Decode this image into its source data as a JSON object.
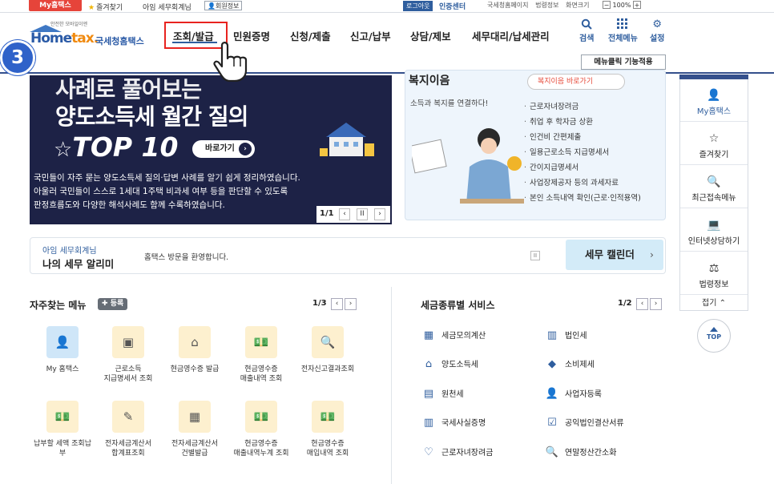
{
  "topbar": {
    "my_hometax": "My홈택스",
    "favorites": "즐겨찾기",
    "user_id": "아임 세무회계님",
    "user_info": "회원정보",
    "logout": "로그아웃",
    "cert_center": "인증센터",
    "links": [
      "국세청홈페이지",
      "법령정보",
      "화면크기"
    ],
    "zoom": "100%"
  },
  "header": {
    "logo_tag": "안전한 모바일이엔",
    "logo_brand_main": "Home",
    "logo_brand_accent": "tax.",
    "logo_kor": "국세청홈택스",
    "gnb": [
      "조회/발급",
      "민원증명",
      "신청/제출",
      "신고/납부",
      "상담/제보",
      "세무대리/납세관리"
    ],
    "util": {
      "search": "검색",
      "all_menu": "전체메뉴",
      "settings": "설정"
    },
    "menu_click": "메뉴클릭 기능적용"
  },
  "step": "3",
  "banner": {
    "line1": "사례로 풀어보는",
    "line2": "양도소득세 월간 질의",
    "line3": "TOP 10",
    "button": "바로가기",
    "desc": [
      "국민들이 자주 묻는 양도소득세 질의·답변 사례를 알기 쉽게 정리하였습니다.",
      "아울러 국민들이 스스로 1세대 1주택 비과세 여부 등을 판단할 수 있도록",
      "판정흐름도와 다양한 해석사례도 함께 수록하였습니다."
    ],
    "page": "1/1"
  },
  "welfare": {
    "title": "복지이음",
    "button": "복지이음 바로가기",
    "subtitle": "소득과 복지를 연결하다!",
    "items": [
      "근로자녀장려금",
      "취업 후 학자금 상환",
      "인건비 간편제출",
      "일용근로소득 지급명세서",
      "간이지급명세서",
      "사업장제공자 등의 과세자료",
      "본인 소득내역 확인(근로·인적용역)"
    ]
  },
  "notice": {
    "user": "아임 세무회계님",
    "title": "나의 세무 알리미",
    "message": "홈택스 방문을 환영합니다.",
    "calendar": "세무 캘린더"
  },
  "quickbar": {
    "items": [
      "My홈택스",
      "즐겨찾기",
      "최근접속메뉴",
      "인터넷상담하기",
      "법령정보"
    ],
    "fold": "접기",
    "top": "TOP"
  },
  "favorites": {
    "title": "자주찾는 메뉴",
    "add": "등록",
    "page": "1/3",
    "items": [
      [
        "My 홈택스"
      ],
      [
        "근로소득",
        "지급명세서 조회"
      ],
      [
        "현금영수증 발급"
      ],
      [
        "현금영수증",
        "매출내역 조회"
      ],
      [
        "전자신고결과조회"
      ],
      [
        "납부할 세액 조회납",
        "부"
      ],
      [
        "전자세금계산서",
        "합계표조회"
      ],
      [
        "전자세금계산서",
        "건별발급"
      ],
      [
        "현금영수증",
        "매출내역누계 조회"
      ],
      [
        "현금영수증",
        "매입내역 조회"
      ]
    ]
  },
  "taxservice": {
    "title": "세금종류별 서비스",
    "page": "1/2",
    "left": [
      "세금모의계산",
      "양도소득세",
      "원천세",
      "국세사실증명",
      "근로자녀장려금"
    ],
    "right": [
      "법인세",
      "소비제세",
      "사업자등록",
      "공익법인결산서류",
      "연말정산간소화"
    ]
  },
  "colors": {
    "accent": "#2f5e9e",
    "highlight_red": "#e8231f",
    "banner_bg": "#1d2246",
    "step_badge": "#2f62c9"
  }
}
